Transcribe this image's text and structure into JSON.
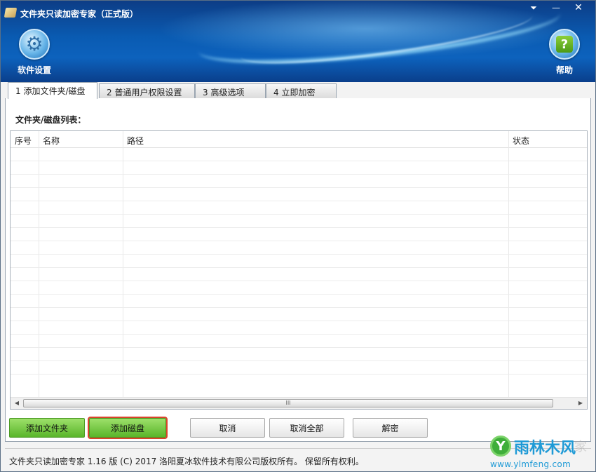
{
  "window": {
    "title": "文件夹只读加密专家（正式版）",
    "controls": {
      "menu": "⏷",
      "minimize": "—",
      "close": "✕"
    }
  },
  "toolbar": {
    "settings_label": "软件设置",
    "help_label": "帮助"
  },
  "tabs": [
    {
      "label": "1 添加文件夹/磁盘",
      "active": true
    },
    {
      "label": "2 普通用户权限设置",
      "active": false
    },
    {
      "label": "3 高级选项",
      "active": false
    },
    {
      "label": "4 立即加密",
      "active": false
    }
  ],
  "main": {
    "list_label": "文件夹/磁盘列表：",
    "columns": [
      "序号",
      "名称",
      "路径",
      "状态"
    ],
    "rows": [],
    "scroll_grip": "III"
  },
  "actions": {
    "add_folder": "添加文件夹",
    "add_disk": "添加磁盘",
    "cancel": "取消",
    "cancel_all": "取消全部",
    "decrypt": "解密"
  },
  "status": {
    "text": "文件夹只读加密专家 1.16 版  (C)  2017 洛阳夏冰软件技术有限公司版权所有。  保留所有权利。"
  },
  "watermark": {
    "name": "雨林木风",
    "url": "www.ylmfeng.com",
    "ghost": "家"
  },
  "colors": {
    "header_blue": "#0a5bb2",
    "button_green": "#59b52a",
    "selected_outline": "#d9442b",
    "watermark_blue": "#1e9ad6"
  },
  "icons": {
    "settings": "gear-icon",
    "help": "help-icon",
    "app": "app-icon"
  }
}
